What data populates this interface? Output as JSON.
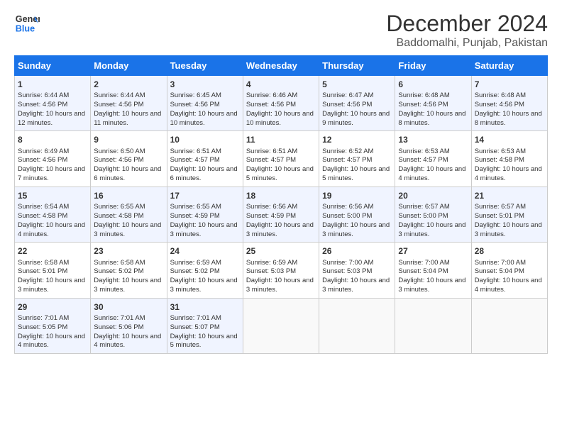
{
  "header": {
    "logo_line1": "General",
    "logo_line2": "Blue",
    "title": "December 2024",
    "subtitle": "Baddomalhi, Punjab, Pakistan"
  },
  "days_of_week": [
    "Sunday",
    "Monday",
    "Tuesday",
    "Wednesday",
    "Thursday",
    "Friday",
    "Saturday"
  ],
  "weeks": [
    [
      {
        "day": 1,
        "sunrise": "6:44 AM",
        "sunset": "4:56 PM",
        "daylight": "10 hours and 12 minutes."
      },
      {
        "day": 2,
        "sunrise": "6:44 AM",
        "sunset": "4:56 PM",
        "daylight": "10 hours and 11 minutes."
      },
      {
        "day": 3,
        "sunrise": "6:45 AM",
        "sunset": "4:56 PM",
        "daylight": "10 hours and 10 minutes."
      },
      {
        "day": 4,
        "sunrise": "6:46 AM",
        "sunset": "4:56 PM",
        "daylight": "10 hours and 10 minutes."
      },
      {
        "day": 5,
        "sunrise": "6:47 AM",
        "sunset": "4:56 PM",
        "daylight": "10 hours and 9 minutes."
      },
      {
        "day": 6,
        "sunrise": "6:48 AM",
        "sunset": "4:56 PM",
        "daylight": "10 hours and 8 minutes."
      },
      {
        "day": 7,
        "sunrise": "6:48 AM",
        "sunset": "4:56 PM",
        "daylight": "10 hours and 8 minutes."
      }
    ],
    [
      {
        "day": 8,
        "sunrise": "6:49 AM",
        "sunset": "4:56 PM",
        "daylight": "10 hours and 7 minutes."
      },
      {
        "day": 9,
        "sunrise": "6:50 AM",
        "sunset": "4:56 PM",
        "daylight": "10 hours and 6 minutes."
      },
      {
        "day": 10,
        "sunrise": "6:51 AM",
        "sunset": "4:57 PM",
        "daylight": "10 hours and 6 minutes."
      },
      {
        "day": 11,
        "sunrise": "6:51 AM",
        "sunset": "4:57 PM",
        "daylight": "10 hours and 5 minutes."
      },
      {
        "day": 12,
        "sunrise": "6:52 AM",
        "sunset": "4:57 PM",
        "daylight": "10 hours and 5 minutes."
      },
      {
        "day": 13,
        "sunrise": "6:53 AM",
        "sunset": "4:57 PM",
        "daylight": "10 hours and 4 minutes."
      },
      {
        "day": 14,
        "sunrise": "6:53 AM",
        "sunset": "4:58 PM",
        "daylight": "10 hours and 4 minutes."
      }
    ],
    [
      {
        "day": 15,
        "sunrise": "6:54 AM",
        "sunset": "4:58 PM",
        "daylight": "10 hours and 4 minutes."
      },
      {
        "day": 16,
        "sunrise": "6:55 AM",
        "sunset": "4:58 PM",
        "daylight": "10 hours and 3 minutes."
      },
      {
        "day": 17,
        "sunrise": "6:55 AM",
        "sunset": "4:59 PM",
        "daylight": "10 hours and 3 minutes."
      },
      {
        "day": 18,
        "sunrise": "6:56 AM",
        "sunset": "4:59 PM",
        "daylight": "10 hours and 3 minutes."
      },
      {
        "day": 19,
        "sunrise": "6:56 AM",
        "sunset": "5:00 PM",
        "daylight": "10 hours and 3 minutes."
      },
      {
        "day": 20,
        "sunrise": "6:57 AM",
        "sunset": "5:00 PM",
        "daylight": "10 hours and 3 minutes."
      },
      {
        "day": 21,
        "sunrise": "6:57 AM",
        "sunset": "5:01 PM",
        "daylight": "10 hours and 3 minutes."
      }
    ],
    [
      {
        "day": 22,
        "sunrise": "6:58 AM",
        "sunset": "5:01 PM",
        "daylight": "10 hours and 3 minutes."
      },
      {
        "day": 23,
        "sunrise": "6:58 AM",
        "sunset": "5:02 PM",
        "daylight": "10 hours and 3 minutes."
      },
      {
        "day": 24,
        "sunrise": "6:59 AM",
        "sunset": "5:02 PM",
        "daylight": "10 hours and 3 minutes."
      },
      {
        "day": 25,
        "sunrise": "6:59 AM",
        "sunset": "5:03 PM",
        "daylight": "10 hours and 3 minutes."
      },
      {
        "day": 26,
        "sunrise": "7:00 AM",
        "sunset": "5:03 PM",
        "daylight": "10 hours and 3 minutes."
      },
      {
        "day": 27,
        "sunrise": "7:00 AM",
        "sunset": "5:04 PM",
        "daylight": "10 hours and 3 minutes."
      },
      {
        "day": 28,
        "sunrise": "7:00 AM",
        "sunset": "5:04 PM",
        "daylight": "10 hours and 4 minutes."
      }
    ],
    [
      {
        "day": 29,
        "sunrise": "7:01 AM",
        "sunset": "5:05 PM",
        "daylight": "10 hours and 4 minutes."
      },
      {
        "day": 30,
        "sunrise": "7:01 AM",
        "sunset": "5:06 PM",
        "daylight": "10 hours and 4 minutes."
      },
      {
        "day": 31,
        "sunrise": "7:01 AM",
        "sunset": "5:07 PM",
        "daylight": "10 hours and 5 minutes."
      },
      null,
      null,
      null,
      null
    ]
  ]
}
